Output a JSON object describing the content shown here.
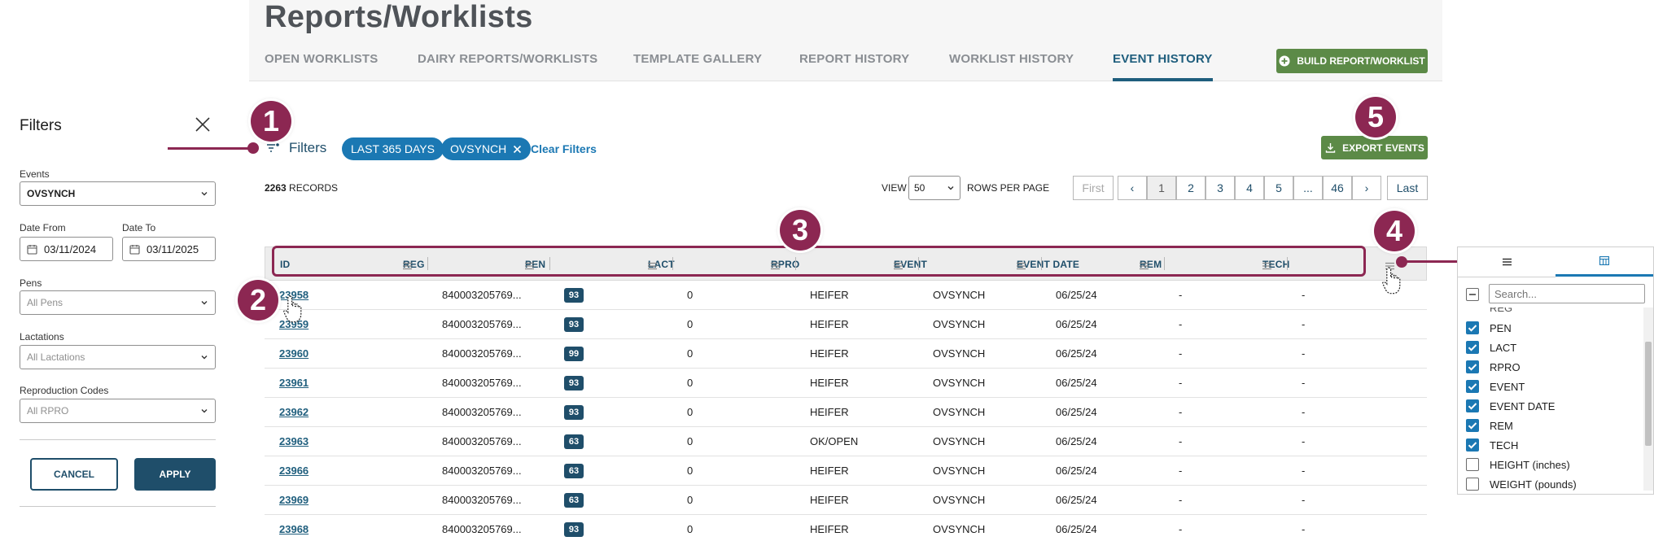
{
  "page": {
    "title": "Reports/Worklists"
  },
  "tabs": [
    "OPEN WORKLISTS",
    "DAIRY REPORTS/WORKLISTS",
    "TEMPLATE GALLERY",
    "REPORT HISTORY",
    "WORKLIST HISTORY",
    "EVENT HISTORY"
  ],
  "active_tab": "EVENT HISTORY",
  "build_button": "BUILD REPORT/WORKLIST",
  "export_button": "EXPORT EVENTS",
  "sidebar": {
    "title": "Filters",
    "events_label": "Events",
    "events_value": "OVSYNCH",
    "date_from_label": "Date From",
    "date_from_value": "03/11/2024",
    "date_to_label": "Date To",
    "date_to_value": "03/11/2025",
    "pens_label": "Pens",
    "pens_placeholder": "All Pens",
    "lactations_label": "Lactations",
    "lactations_placeholder": "All Lactations",
    "repro_label": "Reproduction Codes",
    "repro_placeholder": "All RPRO",
    "cancel": "CANCEL",
    "apply": "APPLY"
  },
  "filter_bar": {
    "filters_label": "Filters",
    "chips": [
      "LAST 365 DAYS",
      "OVSYNCH"
    ],
    "clear": "Clear Filters"
  },
  "records": {
    "count": "2263",
    "label": "RECORDS"
  },
  "paging": {
    "view_label": "VIEW",
    "rows_per_page": "50",
    "rpp_label": "ROWS PER PAGE",
    "first": "First",
    "prev": "‹",
    "pages": [
      "1",
      "2",
      "3",
      "4",
      "5",
      "...",
      "46"
    ],
    "next": "›",
    "last": "Last",
    "current": "1"
  },
  "table": {
    "columns": [
      "ID",
      "REG",
      "PEN",
      "LACT",
      "RPRO",
      "EVENT",
      "EVENT DATE",
      "REM",
      "TECH"
    ],
    "rows": [
      {
        "id": "23958",
        "reg": "840003205769...",
        "pen": "93",
        "lact": "0",
        "rpro": "HEIFER",
        "event": "OVSYNCH",
        "date": "06/25/24",
        "rem": "-",
        "tech": "-"
      },
      {
        "id": "23959",
        "reg": "840003205769...",
        "pen": "93",
        "lact": "0",
        "rpro": "HEIFER",
        "event": "OVSYNCH",
        "date": "06/25/24",
        "rem": "-",
        "tech": "-"
      },
      {
        "id": "23960",
        "reg": "840003205769...",
        "pen": "99",
        "lact": "0",
        "rpro": "HEIFER",
        "event": "OVSYNCH",
        "date": "06/25/24",
        "rem": "-",
        "tech": "-"
      },
      {
        "id": "23961",
        "reg": "840003205769...",
        "pen": "93",
        "lact": "0",
        "rpro": "HEIFER",
        "event": "OVSYNCH",
        "date": "06/25/24",
        "rem": "-",
        "tech": "-"
      },
      {
        "id": "23962",
        "reg": "840003205769...",
        "pen": "93",
        "lact": "0",
        "rpro": "HEIFER",
        "event": "OVSYNCH",
        "date": "06/25/24",
        "rem": "-",
        "tech": "-"
      },
      {
        "id": "23963",
        "reg": "840003205769...",
        "pen": "63",
        "lact": "0",
        "rpro": "OK/OPEN",
        "event": "OVSYNCH",
        "date": "06/25/24",
        "rem": "-",
        "tech": "-"
      },
      {
        "id": "23966",
        "reg": "840003205769...",
        "pen": "63",
        "lact": "0",
        "rpro": "HEIFER",
        "event": "OVSYNCH",
        "date": "06/25/24",
        "rem": "-",
        "tech": "-"
      },
      {
        "id": "23969",
        "reg": "840003205769...",
        "pen": "63",
        "lact": "0",
        "rpro": "HEIFER",
        "event": "OVSYNCH",
        "date": "06/25/24",
        "rem": "-",
        "tech": "-"
      },
      {
        "id": "23968",
        "reg": "840003205769...",
        "pen": "93",
        "lact": "0",
        "rpro": "HEIFER",
        "event": "OVSYNCH",
        "date": "06/25/24",
        "rem": "-",
        "tech": "-"
      }
    ]
  },
  "column_panel": {
    "search_placeholder": "Search...",
    "partial_top": "REG",
    "items": [
      {
        "label": "PEN",
        "checked": true
      },
      {
        "label": "LACT",
        "checked": true
      },
      {
        "label": "RPRO",
        "checked": true
      },
      {
        "label": "EVENT",
        "checked": true
      },
      {
        "label": "EVENT DATE",
        "checked": true
      },
      {
        "label": "REM",
        "checked": true
      },
      {
        "label": "TECH",
        "checked": true
      },
      {
        "label": "HEIGHT (inches)",
        "checked": false
      },
      {
        "label": "WEIGHT (pounds)",
        "checked": false
      }
    ]
  },
  "callouts": [
    "1",
    "2",
    "3",
    "4",
    "5"
  ],
  "colors": {
    "primary": "#1f4e6a",
    "accent": "#1b78b3",
    "green": "#5c8a47",
    "callout": "#8c2752"
  },
  "icons": [
    "close-icon",
    "calendar-icon",
    "chevron-down-icon",
    "filter-icon",
    "plus-circle-icon",
    "download-icon",
    "menu-icon",
    "columns-icon",
    "hand-cursor-icon"
  ]
}
